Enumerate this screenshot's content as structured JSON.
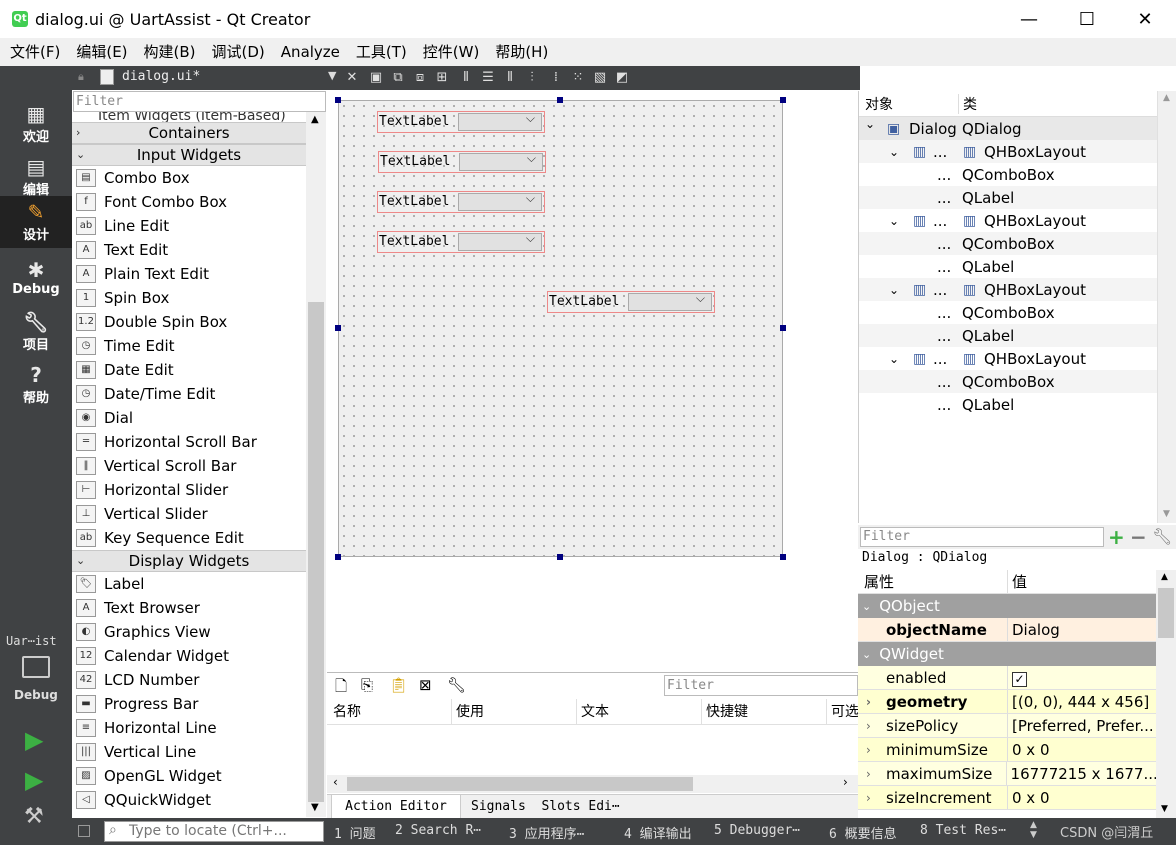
{
  "window": {
    "title": "dialog.ui @ UartAssist - Qt Creator",
    "app_icon": "qt"
  },
  "menu": [
    "文件(F)",
    "编辑(E)",
    "构建(B)",
    "调试(D)",
    "Analyze",
    "工具(T)",
    "控件(W)",
    "帮助(H)"
  ],
  "modes": [
    {
      "label": "欢迎",
      "icon": "grid-icon"
    },
    {
      "label": "编辑",
      "icon": "document-icon"
    },
    {
      "label": "设计",
      "icon": "pencil-icon"
    },
    {
      "label": "Debug",
      "icon": "bug-icon"
    },
    {
      "label": "项目",
      "icon": "wrench-icon"
    },
    {
      "label": "帮助",
      "icon": "help-icon"
    }
  ],
  "kit": {
    "name": "Uar⋯ist",
    "mode": "Debug"
  },
  "editor_tab": {
    "filename": "dialog.ui*"
  },
  "widget_box": {
    "filter_placeholder": "Filter",
    "partial_top": "Item Widgets (Item-Based)",
    "containers": "Containers",
    "input_header": "Input Widgets",
    "input_items": [
      "Combo Box",
      "Font Combo Box",
      "Line Edit",
      "Text Edit",
      "Plain Text Edit",
      "Spin Box",
      "Double Spin Box",
      "Time Edit",
      "Date Edit",
      "Date/Time Edit",
      "Dial",
      "Horizontal Scroll Bar",
      "Vertical Scroll Bar",
      "Horizontal Slider",
      "Vertical Slider",
      "Key Sequence Edit"
    ],
    "display_header": "Display Widgets",
    "display_items": [
      "Label",
      "Text Browser",
      "Graphics View",
      "Calendar Widget",
      "LCD Number",
      "Progress Bar",
      "Horizontal Line",
      "Vertical Line",
      "OpenGL Widget",
      "QQuickWidget"
    ]
  },
  "form": {
    "label_text": "TextLabel"
  },
  "object_inspector": {
    "col_object": "对象",
    "col_class": "类",
    "root": {
      "name": "Dialog",
      "class": "QDialog"
    },
    "layout_class": "QHBoxLayout",
    "ellipsis": "...",
    "combo_class": "QComboBox",
    "label_class": "QLabel"
  },
  "property_editor": {
    "filter_placeholder": "Filter",
    "context": "Dialog : QDialog",
    "col_prop": "属性",
    "col_value": "值",
    "sections": [
      {
        "name": "QObject",
        "rows": [
          {
            "name": "objectName",
            "value": "Dialog",
            "bold": true
          }
        ]
      },
      {
        "name": "QWidget",
        "rows": [
          {
            "name": "enabled",
            "value": "✓"
          },
          {
            "name": "geometry",
            "value": "[(0, 0), 444 x 456]",
            "bold": true
          },
          {
            "name": "sizePolicy",
            "value": "[Preferred, Prefer..."
          },
          {
            "name": "minimumSize",
            "value": "0 x 0"
          },
          {
            "name": "maximumSize",
            "value": "16777215 x 1677..."
          },
          {
            "name": "sizeIncrement",
            "value": "0 x 0"
          }
        ]
      }
    ]
  },
  "action_editor": {
    "filter_placeholder": "Filter",
    "columns": [
      "名称",
      "使用",
      "文本",
      "快捷键",
      "可选"
    ],
    "tabs": [
      "Action Editor",
      "Signals  Slots Edi⋯"
    ]
  },
  "statusbar": {
    "locate_placeholder": "Type to locate (Ctrl+...",
    "items": [
      "1 问题",
      "2 Search R⋯",
      "3 应用程序⋯",
      "4 编译输出",
      "5 Debugger⋯",
      "6 概要信息",
      "8 Test Res⋯"
    ],
    "watermark": "CSDN @闫渭丘"
  },
  "colors": {
    "modebar": "#404244",
    "section_header": "#a0a0a0",
    "selection_handle": "#000080"
  }
}
